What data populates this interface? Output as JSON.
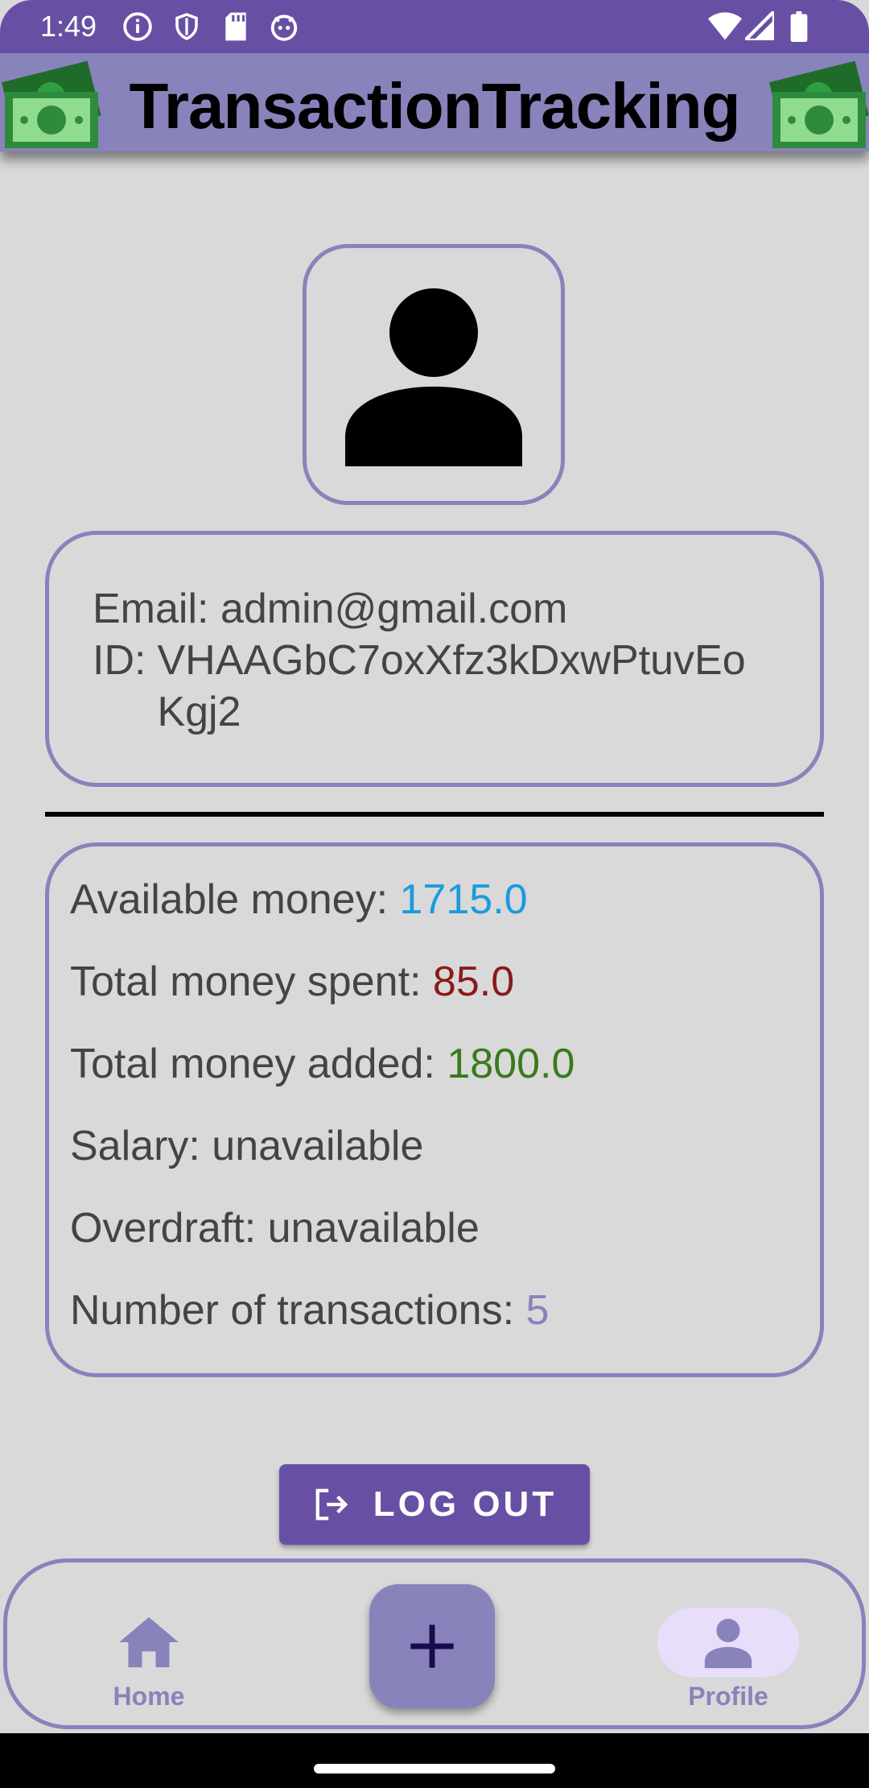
{
  "status_bar": {
    "time": "1:49",
    "icons": [
      "info-icon",
      "shield-icon",
      "sd-card-icon",
      "android-icon",
      "wifi-icon",
      "signal-icon",
      "battery-icon"
    ]
  },
  "app_bar": {
    "title": "TransactionTracking",
    "icon": "money-icon"
  },
  "profile": {
    "avatar_icon": "person-icon",
    "email_label": "Email:",
    "email": "admin@gmail.com",
    "id_label": "ID:",
    "id": "VHAAGbC7oxXfz3kDxwPtuvEoKgj2"
  },
  "stats": {
    "available_label": "Available money:",
    "available": "1715.0",
    "spent_label": "Total money spent:",
    "spent": "85.0",
    "added_label": "Total money added:",
    "added": "1800.0",
    "salary_label": "Salary:",
    "salary": "unavailable",
    "overdraft_label": "Overdraft:",
    "overdraft": "unavailable",
    "transactions_label": "Number of transactions:",
    "transactions": "5"
  },
  "logout": {
    "label": "LOG OUT",
    "icon": "logout-icon"
  },
  "bottom_nav": {
    "home_label": "Home",
    "profile_label": "Profile",
    "add_icon": "plus-icon"
  },
  "colors": {
    "primary": "#6750a4",
    "accent": "#8883bb",
    "available": "#1a9be0",
    "spent": "#8b1a1a",
    "added": "#3a7a1a"
  }
}
